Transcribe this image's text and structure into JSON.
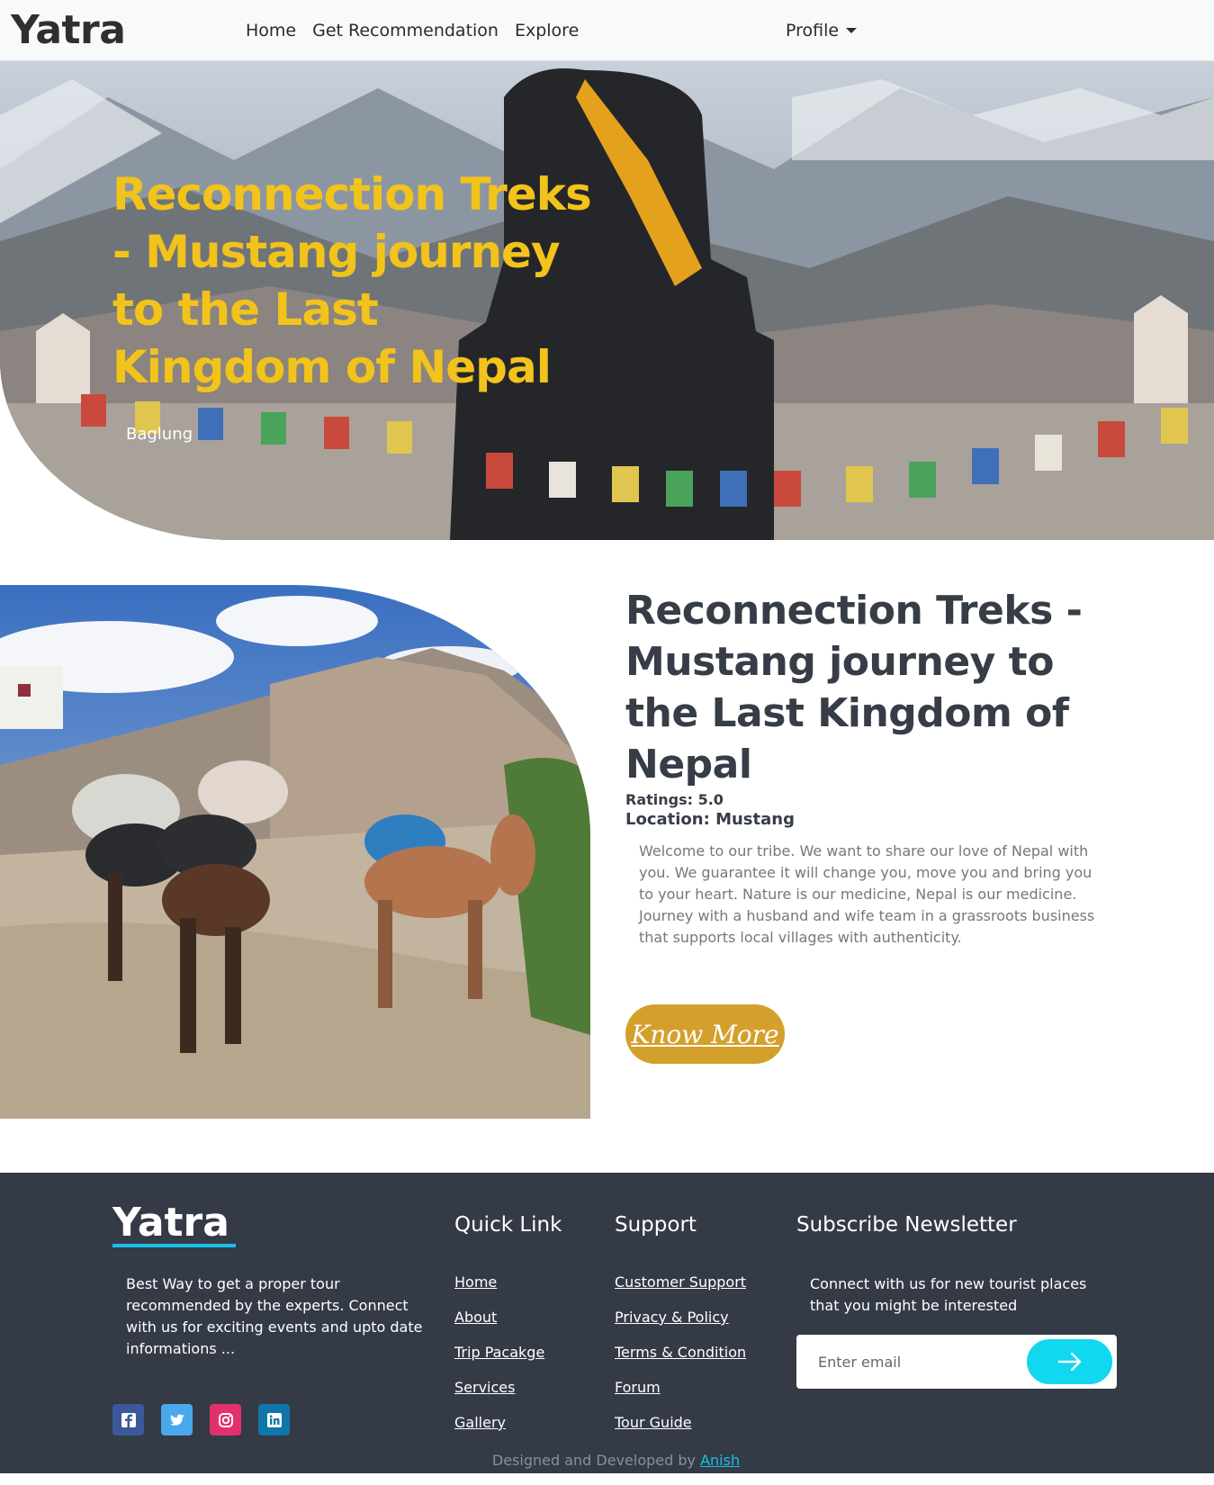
{
  "nav": {
    "brand": "Yatra",
    "links": [
      "Home",
      "Get Recommendation",
      "Explore"
    ],
    "profile": "Profile"
  },
  "hero": {
    "title": "Reconnection Treks - Mustang journey to the Last Kingdom of Nepal",
    "subtitle": "Baglung"
  },
  "feature": {
    "title": "Reconnection Treks - Mustang journey to the Last Kingdom of Nepal",
    "ratings": "Ratings: 5.0",
    "location": "Location: Mustang",
    "description": "Welcome to our tribe. We want to share our love of Nepal with you. We guarantee it will change you, move you and bring you to your heart. Nature is our medicine, Nepal is our medicine. Journey with a husband and wife team in a grassroots business that supports local villages with authenticity.",
    "button": "Know More"
  },
  "footer": {
    "brand": "Yatra",
    "about": "Best Way to get a proper tour recommended by the experts. Connect with us for exciting events and upto date informations ...",
    "quick_link_title": "Quick Link",
    "quick_links": [
      "Home",
      "About",
      "Trip Pacakge",
      "Services",
      "Gallery"
    ],
    "support_title": "Support",
    "support_links": [
      "Customer Support",
      "Privacy & Policy",
      "Terms & Condition",
      "Forum",
      "Tour Guide"
    ],
    "newsletter_title": "Subscribe Newsletter",
    "newsletter_text": "Connect with us for new tourist places that you might be interested",
    "email_placeholder": "Enter email",
    "credit_prefix": "Designed and Developed by",
    "credit_name": "Anish",
    "social": [
      "facebook-icon",
      "twitter-icon",
      "instagram-icon",
      "linkedin-icon"
    ]
  },
  "colors": {
    "hero_title": "#f2c31a",
    "button": "#d4a02c",
    "footer_bg": "#343a46",
    "accent": "#17c1e8",
    "send_button": "#11d8ee"
  }
}
